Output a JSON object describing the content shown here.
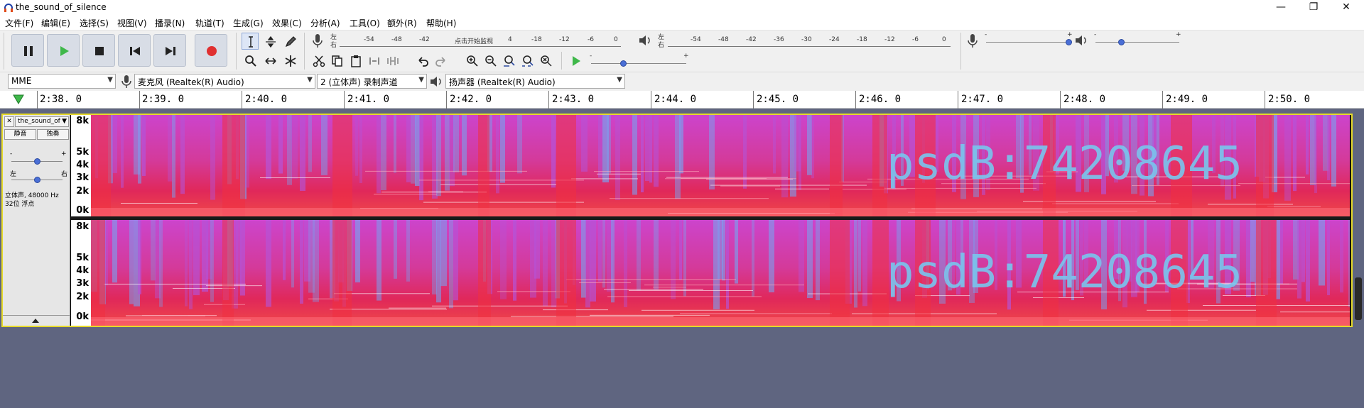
{
  "window": {
    "title": "the_sound_of_silence",
    "minimize": "—",
    "maximize": "❐",
    "close": "✕"
  },
  "menu": [
    "文件(F)",
    "编辑(E)",
    "选择(S)",
    "视图(V)",
    "播录(N)",
    "轨道(T)",
    "生成(G)",
    "效果(C)",
    "分析(A)",
    "工具(O)",
    "额外(R)",
    "帮助(H)"
  ],
  "meters": {
    "record_scale": [
      "-54",
      "-48",
      "-42",
      "点击开始监视",
      "4",
      "-18",
      "-12",
      "-6",
      "0"
    ],
    "play_scale": [
      "-54",
      "-48",
      "-42",
      "-36",
      "-30",
      "-24",
      "-18",
      "-12",
      "-6",
      "0"
    ],
    "lr_left": "左",
    "lr_right": "右"
  },
  "devices": {
    "host": "MME",
    "input": "麦克风 (Realtek(R) Audio)",
    "channels": "2 (立体声) 录制声道",
    "output": "扬声器 (Realtek(R) Audio)"
  },
  "ruler": {
    "labels": [
      "2:38. 0",
      "2:39. 0",
      "2:40. 0",
      "2:41. 0",
      "2:42. 0",
      "2:43. 0",
      "2:44. 0",
      "2:45. 0",
      "2:46. 0",
      "2:47. 0",
      "2:48. 0",
      "2:49. 0",
      "2:50. 0"
    ]
  },
  "track": {
    "name": "the_sound_of",
    "mute": "静音",
    "solo": "独奏",
    "gain_minus": "-",
    "gain_plus": "+",
    "pan_left": "左",
    "pan_right": "右",
    "info_line1": "立体声, 48000 Hz",
    "info_line2": "32位 浮点",
    "freq_labels": [
      "8k",
      "5k",
      "4k",
      "3k",
      "2k",
      "0k"
    ],
    "hidden_text": "psdB:74208645"
  },
  "colors": {
    "spectrogram_base": "#e0285a",
    "spectrogram_high": "#c040e0",
    "spectrogram_cool": "#5a8ce8",
    "track_highlight": "#e6da2a",
    "background": "#5f6580"
  }
}
